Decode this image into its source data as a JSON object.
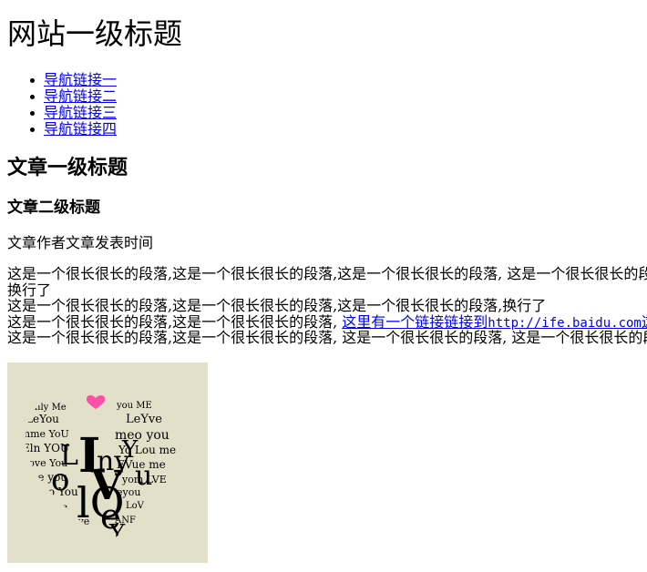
{
  "site": {
    "title": "网站一级标题"
  },
  "nav": {
    "items": [
      {
        "label": "导航链接一"
      },
      {
        "label": "导航链接二"
      },
      {
        "label": "导航链接三"
      },
      {
        "label": "导航链接四"
      }
    ]
  },
  "article": {
    "title": "文章一级标题",
    "subtitle": "文章二级标题",
    "author": "文章作者",
    "published": "文章发表时间",
    "paragraph": {
      "line1": "这是一个很长很长的段落,这是一个很长很长的段落,这是一个很长很长的段落, 这是一个很长很长的段落,",
      "line2": "换行了",
      "line3": "这是一个很长很长的段落,这是一个很长很长的段落,这是一个很长很长的段落,换行了",
      "line4_prefix": "这是一个很长很长的段落,这是一个很长很长的段落, ",
      "line4_link_text": "这里有一个链接链接到",
      "line4_link_url_text": "http://ife.baidu.com",
      "line4_link_suffix": "这",
      "line5": "这是一个很长很长的段落,这是一个很长很长的段落, 这是一个很长很长的段落, 这是一个很长很长的段落,"
    },
    "image": {
      "icon": "heart-typography-image",
      "background_color": "#e3e0ca",
      "heart_color": "#ff4fa8",
      "text_color": "#000000"
    }
  }
}
